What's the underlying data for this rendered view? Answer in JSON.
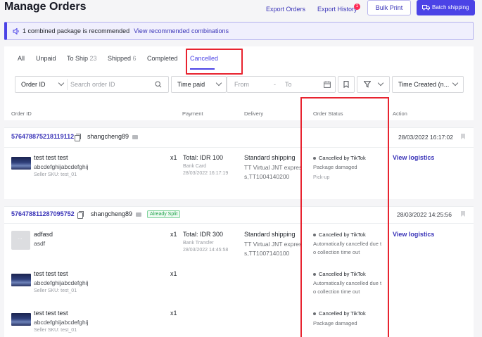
{
  "header": {
    "title": "Manage Orders",
    "export_orders": "Export Orders",
    "export_history": "Export History",
    "export_history_badge": "1",
    "bulk_print": "Bulk Print",
    "batch_shipping": "Batch shipping"
  },
  "banner": {
    "text": "1 combined package is recommended",
    "link": "View recommended combinations"
  },
  "tabs": [
    {
      "label": "All",
      "count": ""
    },
    {
      "label": "Unpaid",
      "count": ""
    },
    {
      "label": "To Ship",
      "count": "23"
    },
    {
      "label": "Shipped",
      "count": "6"
    },
    {
      "label": "Completed",
      "count": ""
    },
    {
      "label": "Cancelled",
      "count": "",
      "active": true
    }
  ],
  "filters": {
    "search_type": "Order ID",
    "search_placeholder": "Search order ID",
    "time_type": "Time paid",
    "from_placeholder": "From",
    "range_sep": "-",
    "to_placeholder": "To",
    "sort": "Time Created (n..."
  },
  "columns": {
    "order_id": "Order ID",
    "payment": "Payment",
    "delivery": "Delivery",
    "order_status": "Order Status",
    "action": "Action"
  },
  "orders": [
    {
      "id": "576478875218119112",
      "buyer": "shangcheng89",
      "date": "28/03/2022 16:17:02",
      "items": [
        {
          "name": "test test test",
          "variant": "abcdefghijabcdefghij",
          "sku": "Seller SKU: test_01",
          "qty": "x1",
          "total": "Total: IDR 100",
          "method": "Bank Card",
          "paid_time": "28/03/2022 16:17:19",
          "shipping": "Standard shipping",
          "carrier_line1": "TT Virtual JNT expres",
          "carrier_line2": "s,TT1004140200",
          "status": "Cancelled by TikTok",
          "reason": "Package damaged",
          "stage": "Pick-up",
          "action": "View logistics"
        }
      ]
    },
    {
      "id": "576478811287095752",
      "buyer": "shangcheng89",
      "tag": "Already Split",
      "date": "28/03/2022 14:25:56",
      "items": [
        {
          "name": "adfasd",
          "variant": "asdf",
          "qty": "x1",
          "total": "Total: IDR 300",
          "method": "Bank Transfer",
          "paid_time": "28/03/2022 14:45:58",
          "shipping": "Standard shipping",
          "carrier_line1": "TT Virtual JNT expres",
          "carrier_line2": "s,TT1007140100",
          "status": "Cancelled by TikTok",
          "reason_line1": "Automatically cancelled due t",
          "reason_line2": "o collection time out",
          "action": "View logistics"
        },
        {
          "name": "test test test",
          "variant": "abcdefghijabcdefghij",
          "sku": "Seller SKU: test_01",
          "qty": "x1",
          "status": "Cancelled by TikTok",
          "reason_line1": "Automatically cancelled due t",
          "reason_line2": "o collection time out"
        },
        {
          "name": "test test test",
          "variant": "abcdefghijabcdefghij",
          "sku": "Seller SKU: test_01",
          "qty": "x1",
          "status": "Cancelled by TikTok",
          "reason": "Package damaged"
        }
      ]
    }
  ]
}
